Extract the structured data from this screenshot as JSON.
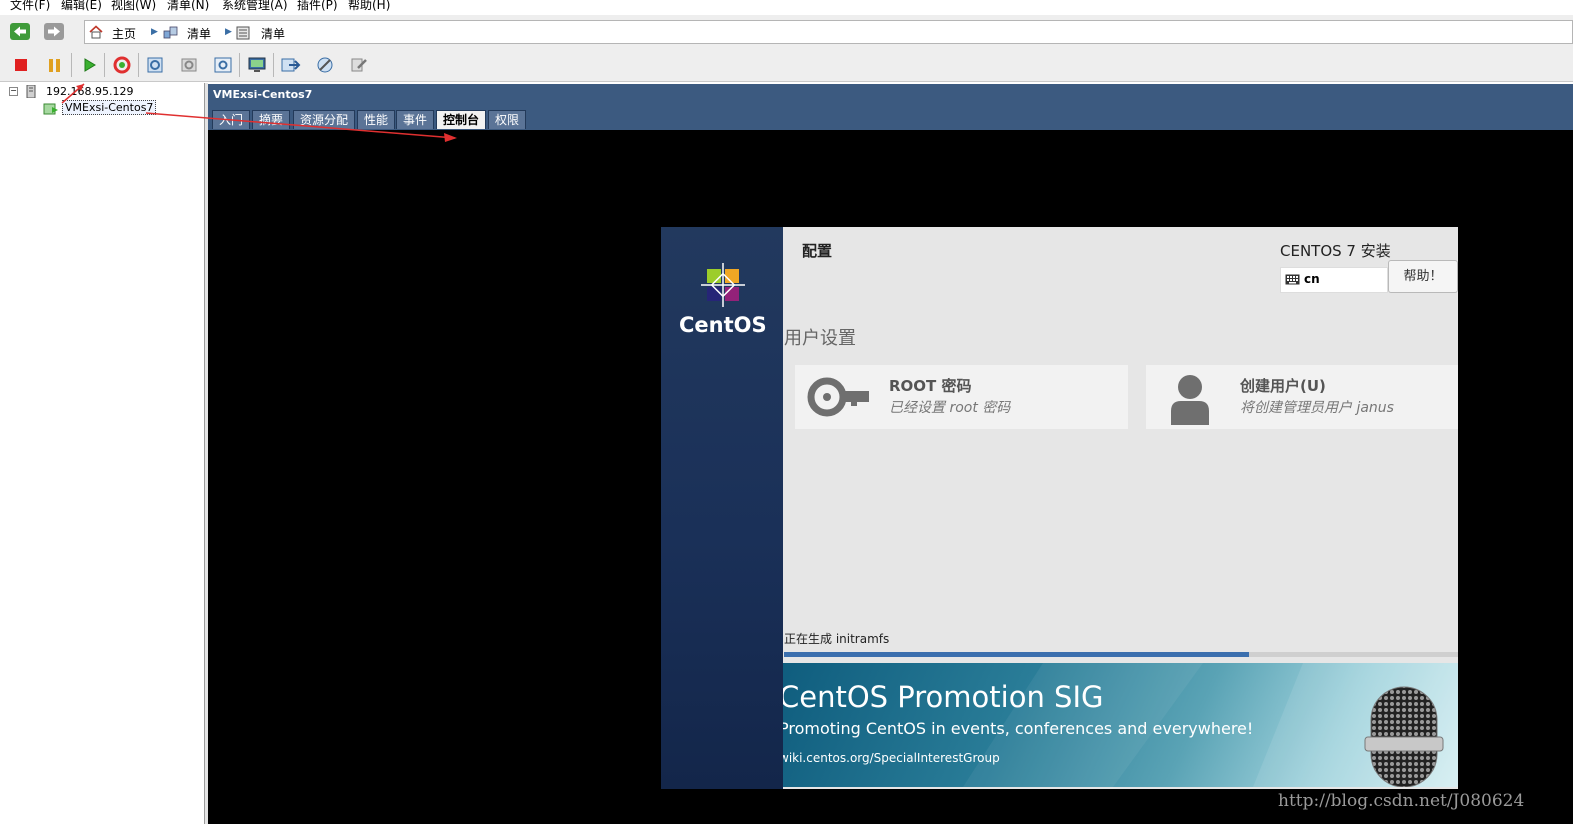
{
  "menubar": {
    "items": [
      "文件(F)",
      "编辑(E)",
      "视图(W)",
      "清单(N)",
      "系统管理(A)",
      "插件(P)",
      "帮助(H)"
    ]
  },
  "nav": {
    "back_icon": "back-arrow-icon",
    "forward_icon": "forward-arrow-icon",
    "breadcrumb": [
      {
        "label": "主页",
        "icon": "home-icon"
      },
      {
        "label": "清单",
        "icon": "inventory-icon"
      },
      {
        "label": "清单",
        "icon": "inventory-list-icon"
      }
    ]
  },
  "toolbar": {
    "buttons": [
      "stop-icon",
      "pause-icon",
      "play-icon",
      "reset-icon",
      "snapshot-icon",
      "snapshot-revert-icon",
      "snapshot-manager-icon",
      "console-icon",
      "migrate-icon",
      "settings-icon",
      "permissions-icon"
    ]
  },
  "tree": {
    "host": "192.168.95.129",
    "vm": "VMExsi-Centos7"
  },
  "vm_panel": {
    "title": "VMExsi-Centos7",
    "tabs": [
      "入门",
      "摘要",
      "资源分配",
      "性能",
      "事件",
      "控制台",
      "权限"
    ],
    "active_tab": "控制台"
  },
  "installer": {
    "logo_text": "CentOS",
    "config_title": "配置",
    "install_title": "CENTOS 7 安装",
    "keyboard_layout": "cn",
    "help_button": "帮助！",
    "section_title": "用户设置",
    "spokes": [
      {
        "title": "ROOT 密码",
        "status": "已经设置 root 密码",
        "icon": "key-icon"
      },
      {
        "title": "创建用户(U)",
        "status": "将创建管理员用户 janus",
        "icon": "user-icon"
      }
    ],
    "progress_text": "正在生成 initramfs",
    "progress": 0.69,
    "banner": {
      "title": "CentOS Promotion SIG",
      "subtitle": "Promoting CentOS in events, conferences and everywhere!",
      "link": "wiki.centos.org/SpecialInterestGroup"
    }
  },
  "watermark": "http://blog.csdn.net/J080624",
  "colors": {
    "header_blue": "#3c5a80",
    "annotation_red": "#e03030",
    "progress_blue": "#3b6fae"
  }
}
